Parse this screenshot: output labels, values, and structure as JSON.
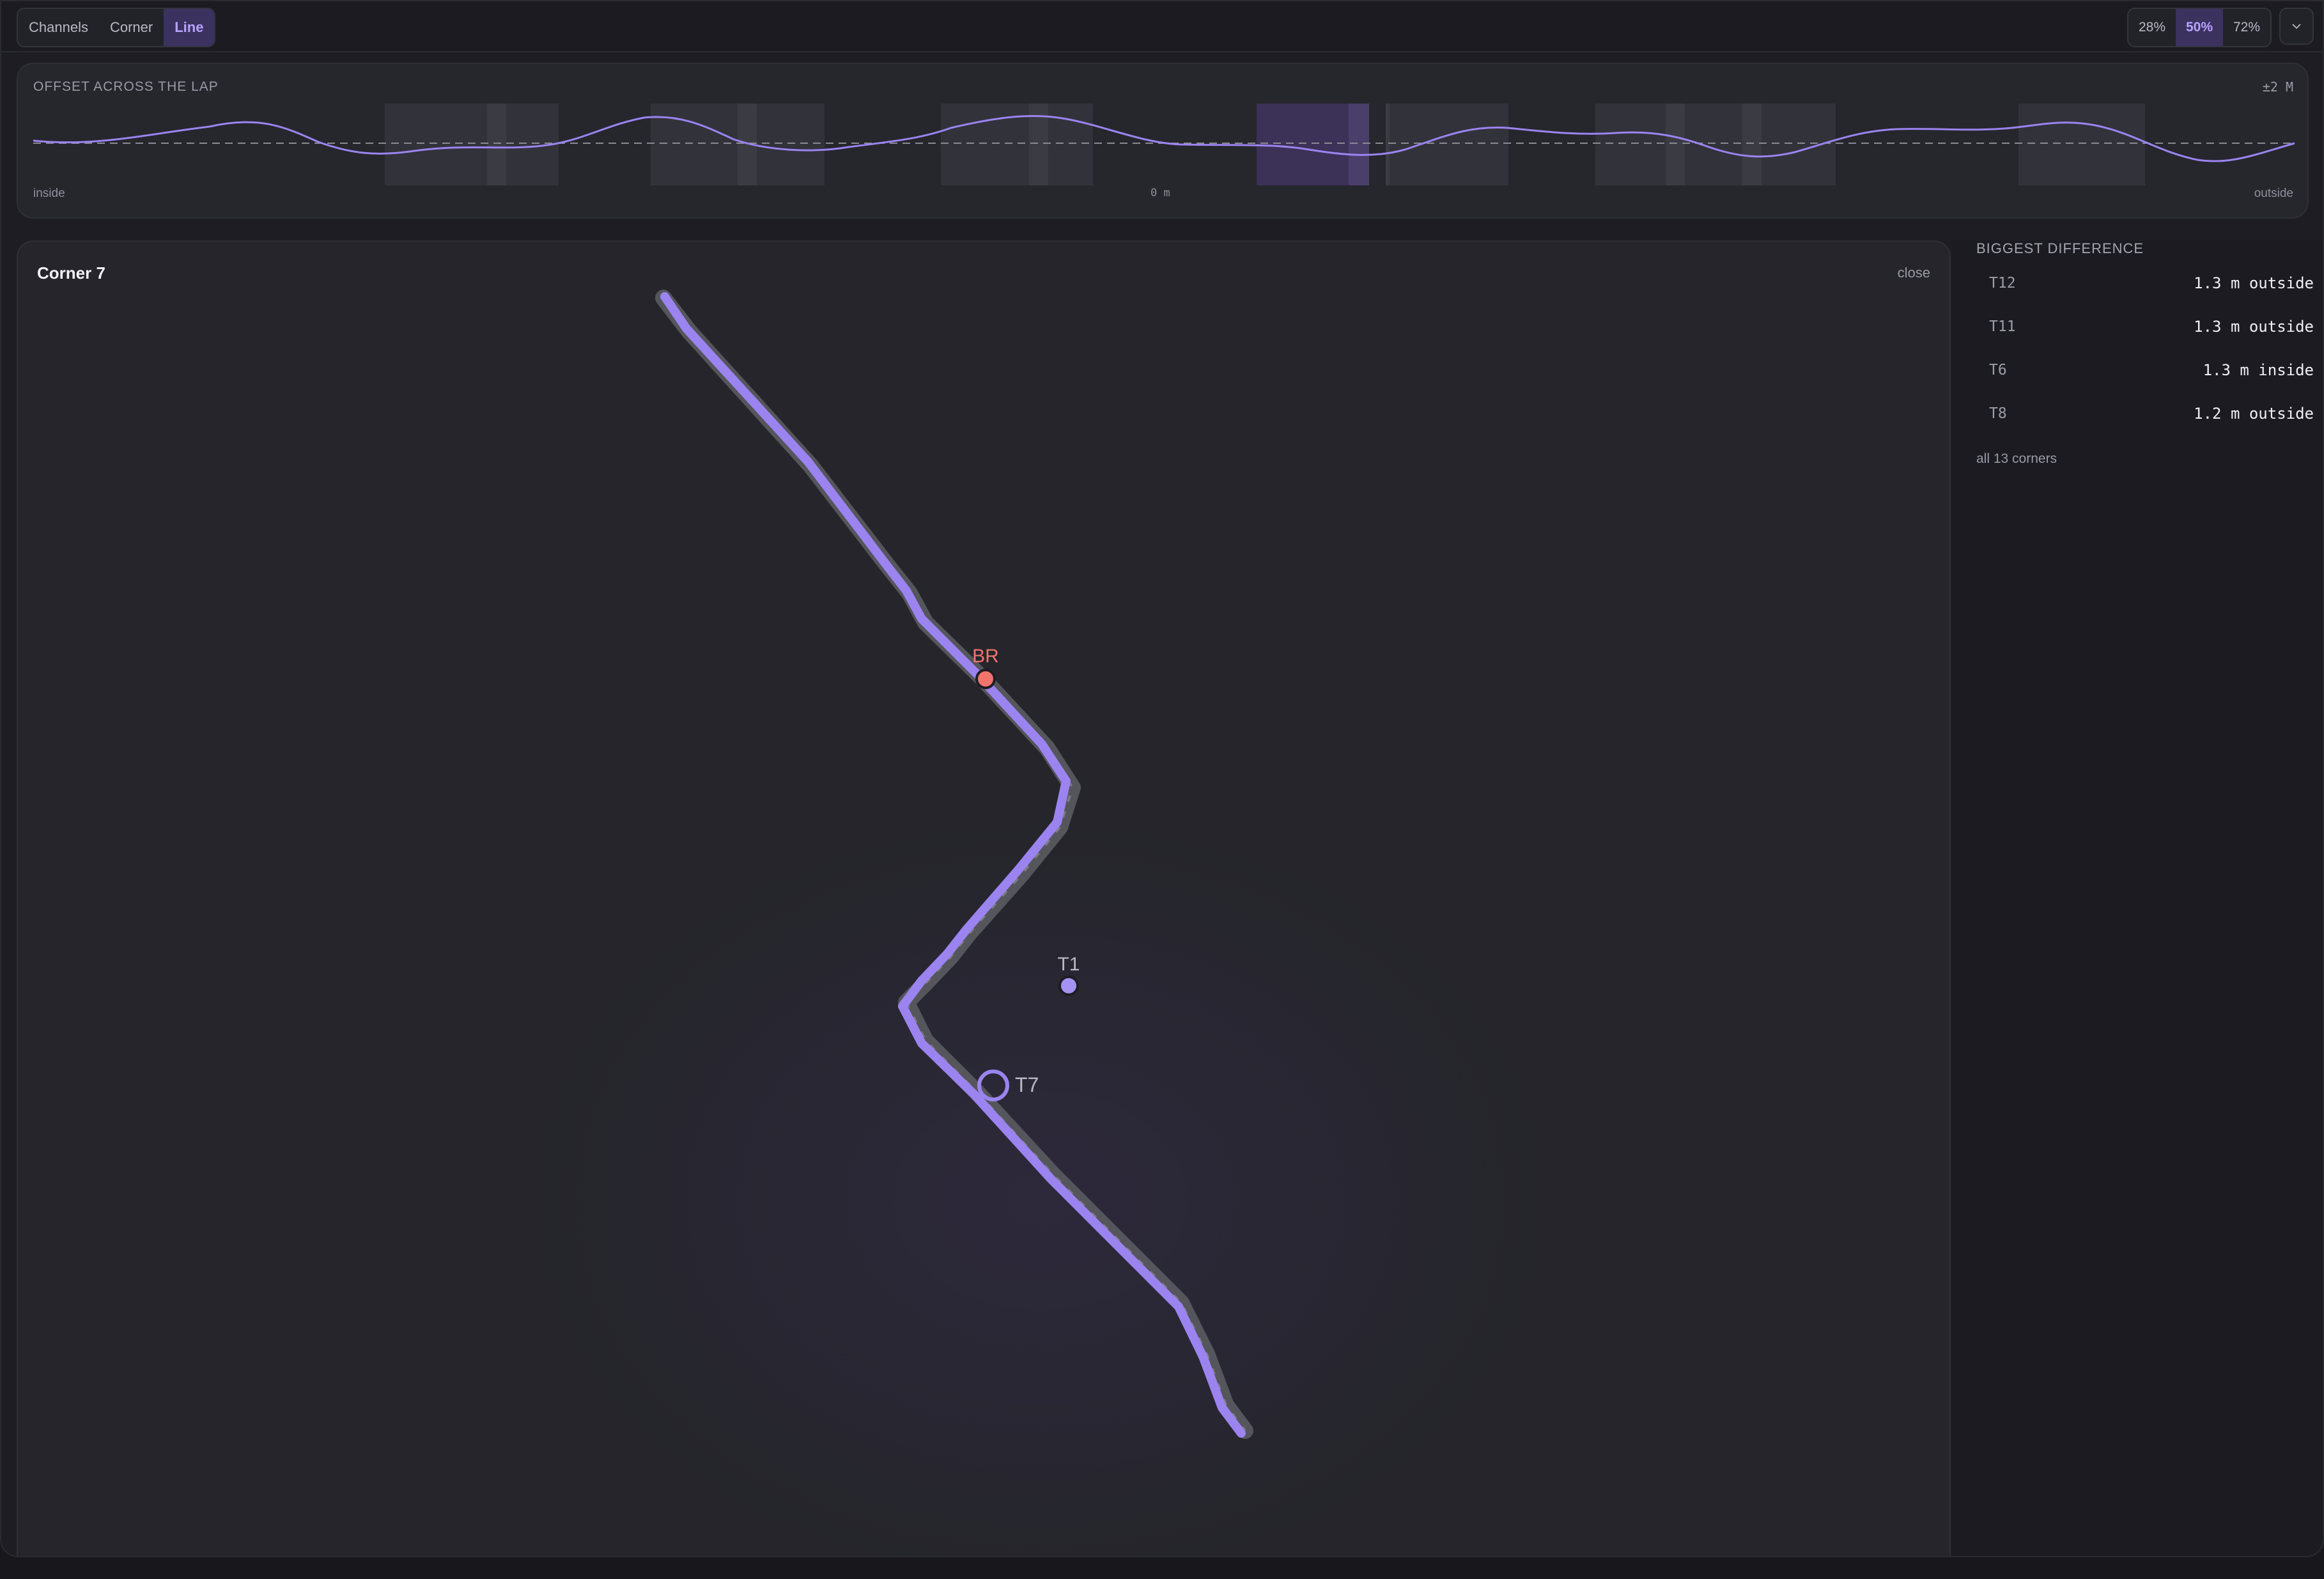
{
  "toolbar": {
    "modes": [
      {
        "label": "Channels",
        "active": false
      },
      {
        "label": "Corner",
        "active": false
      },
      {
        "label": "Line",
        "active": true
      }
    ],
    "zoom": [
      {
        "label": "28%",
        "active": false
      },
      {
        "label": "50%",
        "active": true
      },
      {
        "label": "72%",
        "active": false
      }
    ],
    "menu_icon": "chevron-down-icon"
  },
  "offset_strip": {
    "title": "OFFSET ACROSS THE LAP",
    "range": "±2 M",
    "left_label": "inside",
    "center_label": "0 m",
    "right_label": "outside"
  },
  "corner_view": {
    "title": "Corner 7",
    "close_label": "close",
    "markers": {
      "brake": "BR",
      "throttle": "T1",
      "apex": "T7"
    },
    "colors": {
      "line": "#9b84f0",
      "reference": "#55555c",
      "brake": "#f0746c",
      "throttle": "#a592f2"
    }
  },
  "sidebar": {
    "title": "BIGGEST DIFFERENCE",
    "rows": [
      {
        "turn": "T12",
        "value": "1.3 m outside"
      },
      {
        "turn": "T11",
        "value": "1.3 m outside"
      },
      {
        "turn": "T6",
        "value": "1.3 m inside"
      },
      {
        "turn": "T8",
        "value": "1.2 m outside"
      }
    ],
    "all_link": "all 13 corners"
  }
}
